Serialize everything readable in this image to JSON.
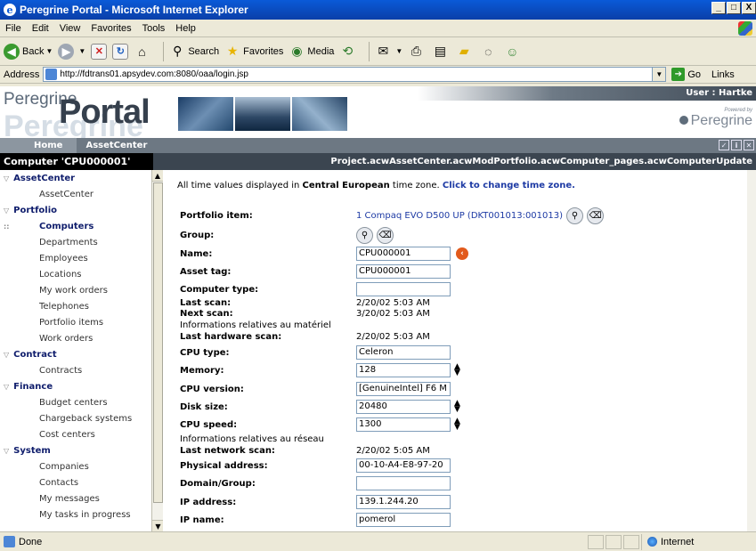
{
  "window": {
    "title": "Peregrine Portal - Microsoft Internet Explorer",
    "controls": [
      "_",
      "□",
      "X"
    ]
  },
  "menu": [
    "File",
    "Edit",
    "View",
    "Favorites",
    "Tools",
    "Help"
  ],
  "toolbar": {
    "back": "Back",
    "search": "Search",
    "favorites": "Favorites",
    "media": "Media"
  },
  "address": {
    "label": "Address",
    "url": "http://fdtrans01.apsydev.com:8080/oaa/login.jsp",
    "go": "Go",
    "links": "Links"
  },
  "portal": {
    "logo_peregrine": "Peregrine",
    "logo_portal": "Portal",
    "user": "User : Hartke",
    "powered_by": "Powered by",
    "brand": "Peregrine"
  },
  "nav": {
    "home": "Home",
    "assetcenter": "AssetCenter"
  },
  "page": {
    "title": "Computer 'CPU000001'",
    "path": "Project.acwAssetCenter.acwModPortfolio.acwComputer_pages.acwComputerUpdate"
  },
  "sidebar": {
    "assetcenter_cat": "AssetCenter",
    "assetcenter_item": "AssetCenter",
    "portfolio_cat": "Portfolio",
    "portfolio_items": [
      "Computers",
      "Departments",
      "Employees",
      "Locations",
      "My work orders",
      "Telephones",
      "Portfolio items",
      "Work orders"
    ],
    "contract_cat": "Contract",
    "contract_items": [
      "Contracts"
    ],
    "finance_cat": "Finance",
    "finance_items": [
      "Budget centers",
      "Chargeback systems",
      "Cost centers"
    ],
    "system_cat": "System",
    "system_items": [
      "Companies",
      "Contacts",
      "My messages",
      "My tasks in progress"
    ]
  },
  "timezone": {
    "prefix": "All time values displayed in ",
    "zone": "Central European",
    "suffix": " time zone. ",
    "link": "Click to change time zone."
  },
  "form": {
    "portfolio_item_label": "Portfolio item:",
    "portfolio_item_value": "1 Compaq EVO D500 UP (DKT001013:001013)",
    "group_label": "Group:",
    "name_label": "Name:",
    "name_value": "CPU000001",
    "asset_tag_label": "Asset tag:",
    "asset_tag_value": "CPU000001",
    "computer_type_label": "Computer type:",
    "computer_type_value": "",
    "last_scan_label": "Last scan:",
    "last_scan_value": "2/20/02 5:03 AM",
    "next_scan_label": "Next scan:",
    "next_scan_value": "3/20/02 5:03 AM",
    "hardware_note": "Informations relatives au matériel",
    "last_hw_scan_label": "Last hardware scan:",
    "last_hw_scan_value": "2/20/02 5:03 AM",
    "cpu_type_label": "CPU type:",
    "cpu_type_value": "Celeron",
    "memory_label": "Memory:",
    "memory_value": "128",
    "cpu_version_label": "CPU version:",
    "cpu_version_value": "[GenuineIntel] F6 M",
    "disk_size_label": "Disk size:",
    "disk_size_value": "20480",
    "cpu_speed_label": "CPU speed:",
    "cpu_speed_value": "1300",
    "network_note": "Informations relatives au réseau",
    "last_net_scan_label": "Last network scan:",
    "last_net_scan_value": "2/20/02 5:05 AM",
    "physical_address_label": "Physical address:",
    "physical_address_value": "00-10-A4-E8-97-20",
    "domain_label": "Domain/Group:",
    "domain_value": "",
    "ip_address_label": "IP address:",
    "ip_address_value": "139.1.244.20",
    "ip_name_label": "IP name:",
    "ip_name_value": "pomerol"
  },
  "status": {
    "done": "Done",
    "zone": "Internet"
  }
}
